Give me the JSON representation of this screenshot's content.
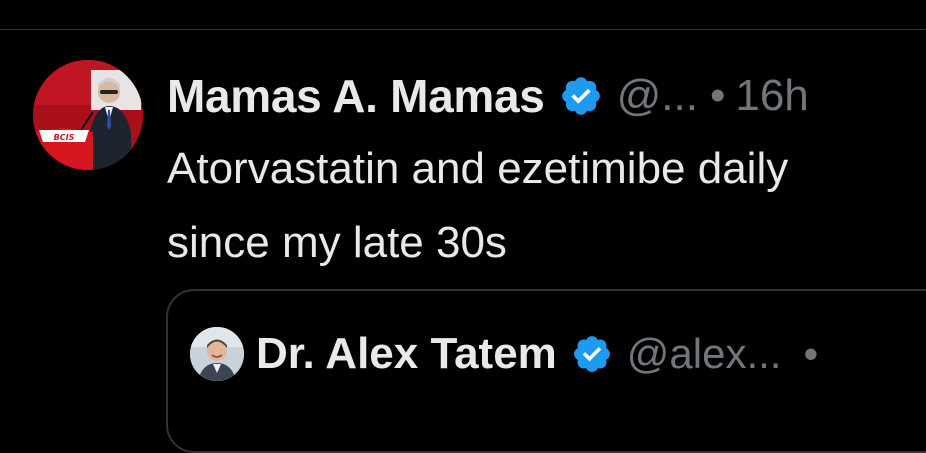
{
  "tweet": {
    "author_name": "Mamas A. Mamas",
    "handle": "@...",
    "separator": "•",
    "time": "16h",
    "text_lines": [
      "Atorvastatin and ezetimibe daily",
      "since my late 30s"
    ],
    "avatar_icon": "profile-photo-speaker-at-podium",
    "avatar_banner_text": "BCIS",
    "verified_icon": "verified-badge-icon"
  },
  "quote": {
    "author_name": "Dr. Alex Tatem",
    "handle": "@alex...",
    "separator": "•",
    "avatar_icon": "profile-photo-smiling-man",
    "verified_icon": "verified-badge-icon"
  },
  "colors": {
    "background": "#000000",
    "text_primary": "#e7e9ea",
    "text_secondary": "#71767b",
    "border": "#2f3336",
    "verified_blue": "#1d9bf0"
  }
}
